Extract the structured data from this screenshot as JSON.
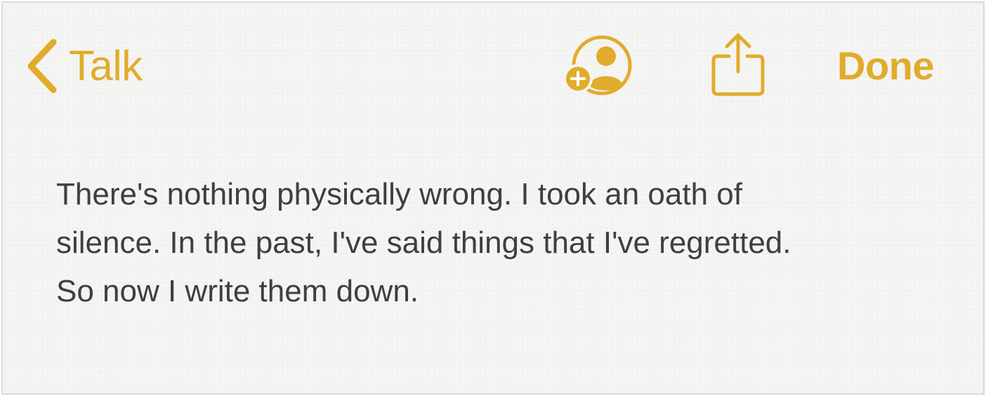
{
  "colors": {
    "accent": "#e1ac2b",
    "text": "#3f3f3f",
    "background": "#f4f4f3"
  },
  "toolbar": {
    "back_label": "Talk",
    "back_icon": "chevron-left-icon",
    "collaborate_icon": "add-person-icon",
    "share_icon": "share-icon",
    "done_label": "Done"
  },
  "note": {
    "lines": [
      "There's nothing physically wrong. I took an oath of",
      "silence. In the past, I've said things that I've regretted.",
      "So now I write them down."
    ]
  }
}
